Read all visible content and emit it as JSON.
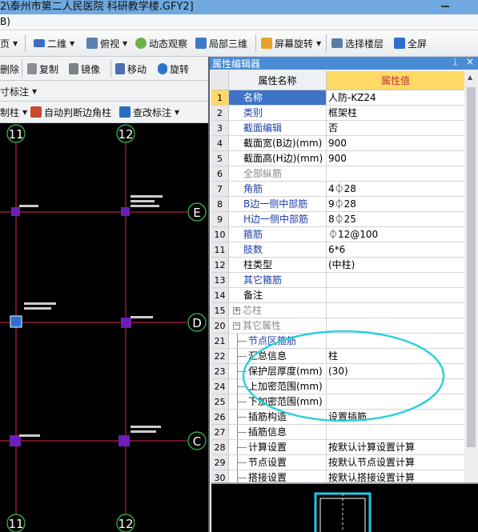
{
  "window": {
    "title": "2\\泰州市第二人民医院 科研教学楼.GFY2]"
  },
  "menubar": {
    "fragment": "B)"
  },
  "toolbar_main": {
    "page_label": "页",
    "view_2d": "二维",
    "top_view": "俯视",
    "dynamic_view": "动态观察",
    "local_3d": "局部三维",
    "screen_rotate": "屏幕旋转",
    "select_floor": "选择楼层",
    "fullscreen": "全屏"
  },
  "toolbar_edit": {
    "delete": "删除",
    "copy": "复制",
    "mirror": "镜像",
    "move": "移动",
    "rotate": "旋转"
  },
  "toolbar_annot": {
    "annotate": "寸标注"
  },
  "toolbar_column": {
    "column": "制柱",
    "auto_corner": "自动判断边角柱",
    "check_annot": "查改标注"
  },
  "canvas": {
    "axes_top": [
      "11",
      "12"
    ],
    "axes_bottom": [
      "11",
      "12"
    ],
    "axes_right": [
      "E",
      "D",
      "C"
    ]
  },
  "property_editor": {
    "title": "属性编辑器",
    "pin": "ᛣ",
    "close": "×",
    "col_name": "属性名称",
    "col_value": "属性值",
    "rows": [
      {
        "no": "1",
        "name": "名称",
        "value": "人防-KZ24",
        "style": "sel"
      },
      {
        "no": "2",
        "name": "类别",
        "value": "框架柱",
        "style": "blue"
      },
      {
        "no": "3",
        "name": "截面编辑",
        "value": "否",
        "style": "blue"
      },
      {
        "no": "4",
        "name": "截面宽(B边)(mm)",
        "value": "900",
        "style": ""
      },
      {
        "no": "5",
        "name": "截面高(H边)(mm)",
        "value": "900",
        "style": ""
      },
      {
        "no": "6",
        "name": "全部纵筋",
        "value": "",
        "style": "gray"
      },
      {
        "no": "7",
        "name": "角筋",
        "value": "4⏀28",
        "style": "blue"
      },
      {
        "no": "8",
        "name": "B边一侧中部筋",
        "value": "9⏀28",
        "style": "blue"
      },
      {
        "no": "9",
        "name": "H边一侧中部筋",
        "value": "8⏀25",
        "style": "blue"
      },
      {
        "no": "10",
        "name": "箍筋",
        "value": "⏀12@100",
        "style": "blue"
      },
      {
        "no": "11",
        "name": "肢数",
        "value": "6*6",
        "style": "blue"
      },
      {
        "no": "12",
        "name": "柱类型",
        "value": "(中柱)",
        "style": ""
      },
      {
        "no": "13",
        "name": "其它箍筋",
        "value": "",
        "style": "blue"
      },
      {
        "no": "14",
        "name": "备注",
        "value": "",
        "style": ""
      },
      {
        "no": "15",
        "name": "芯柱",
        "value": "",
        "style": "group-plus"
      },
      {
        "no": "20",
        "name": "其它属性",
        "value": "",
        "style": "group-minus"
      },
      {
        "no": "21",
        "name": "节点区箍筋",
        "value": "",
        "style": "tree-blue"
      },
      {
        "no": "22",
        "name": "汇总信息",
        "value": "柱",
        "style": "tree"
      },
      {
        "no": "23",
        "name": "保护层厚度(mm)",
        "value": "(30)",
        "style": "tree"
      },
      {
        "no": "24",
        "name": "上加密范围(mm)",
        "value": "",
        "style": "tree"
      },
      {
        "no": "25",
        "name": "下加密范围(mm)",
        "value": "",
        "style": "tree"
      },
      {
        "no": "26",
        "name": "插筋构造",
        "value": "设置插筋",
        "style": "tree"
      },
      {
        "no": "27",
        "name": "插筋信息",
        "value": "",
        "style": "tree"
      },
      {
        "no": "28",
        "name": "计算设置",
        "value": "按默认计算设置计算",
        "style": "tree"
      },
      {
        "no": "29",
        "name": "节点设置",
        "value": "按默认节点设置计算",
        "style": "tree"
      },
      {
        "no": "30",
        "name": "搭接设置",
        "value": "按默认搭接设置计算",
        "style": "tree"
      }
    ]
  },
  "colors": {
    "title_bar": "#6fa9df",
    "panel_title": "#4a8cd4",
    "selected_name": "#3d74c7",
    "value_header": "#ffd966",
    "axis_line": "#e0284a",
    "axis_bubble": "#38c24a",
    "column_fill": "#6a1fb8",
    "annotation_ellipse": "#2fd0d8"
  }
}
